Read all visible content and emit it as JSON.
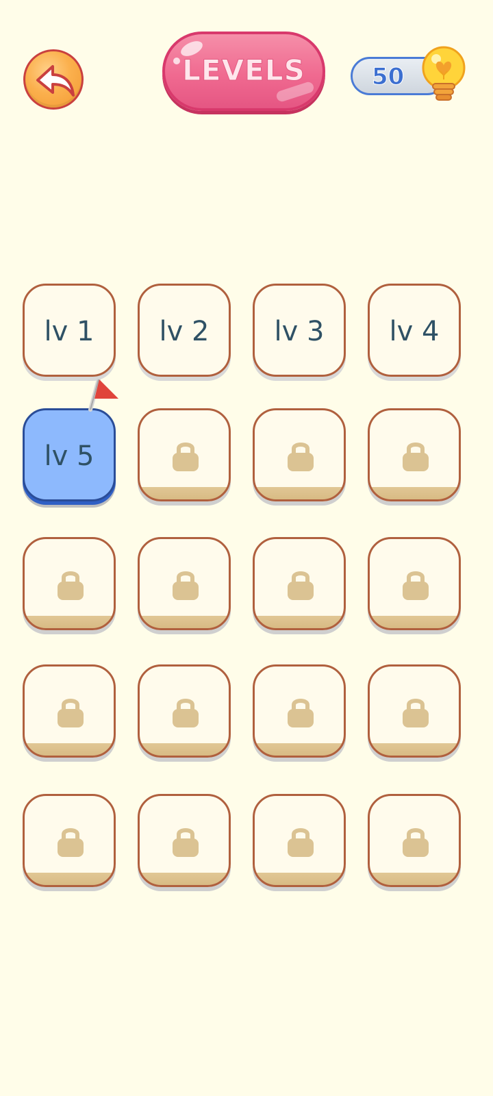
{
  "header": {
    "title": "LEVELS",
    "coins": "50",
    "back_icon": "back-arrow-icon",
    "currency_icon": "lightbulb-heart-icon"
  },
  "colors": {
    "background": "#fffde9",
    "title_badge": "#f06a90",
    "current_level": "#8db9fd",
    "tile_border": "#b0603e",
    "lock": "#dbc393",
    "flag": "#e0443b"
  },
  "levels": [
    {
      "label": "lv 1",
      "state": "unlocked"
    },
    {
      "label": "lv 2",
      "state": "unlocked"
    },
    {
      "label": "lv 3",
      "state": "unlocked"
    },
    {
      "label": "lv 4",
      "state": "unlocked"
    },
    {
      "label": "lv 5",
      "state": "current"
    },
    {
      "label": "",
      "state": "locked"
    },
    {
      "label": "",
      "state": "locked"
    },
    {
      "label": "",
      "state": "locked"
    },
    {
      "label": "",
      "state": "locked"
    },
    {
      "label": "",
      "state": "locked"
    },
    {
      "label": "",
      "state": "locked"
    },
    {
      "label": "",
      "state": "locked"
    },
    {
      "label": "",
      "state": "locked"
    },
    {
      "label": "",
      "state": "locked"
    },
    {
      "label": "",
      "state": "locked"
    },
    {
      "label": "",
      "state": "locked"
    },
    {
      "label": "",
      "state": "locked"
    },
    {
      "label": "",
      "state": "locked"
    },
    {
      "label": "",
      "state": "locked"
    },
    {
      "label": "",
      "state": "locked"
    }
  ]
}
